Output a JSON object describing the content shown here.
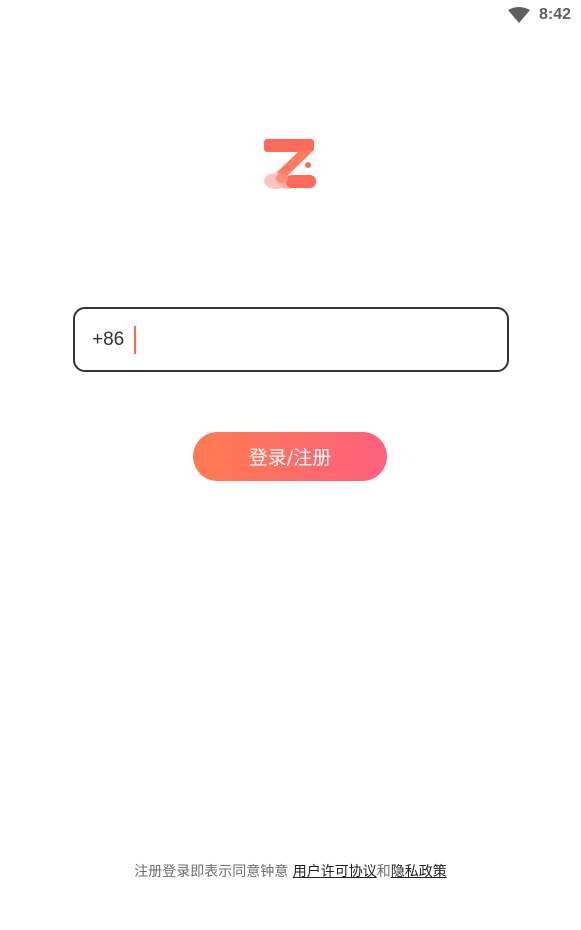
{
  "status_bar": {
    "time": "8:42",
    "icons": [
      "wifi-icon"
    ]
  },
  "logo": {
    "icon": "z-logo-icon",
    "colors": [
      "#ff6b5a",
      "#ff8a7a",
      "#ffc4c0"
    ]
  },
  "phone_input": {
    "country_code": "+86",
    "value": "",
    "placeholder": ""
  },
  "login_button": {
    "label": "登录/注册",
    "gradient": [
      "#ff7c4f",
      "#ff5f7e"
    ]
  },
  "agreement": {
    "prefix": "注册登录即表示同意钟意 ",
    "user_agreement": "用户许可协议",
    "conjunction": "和",
    "privacy_policy": "隐私政策"
  }
}
